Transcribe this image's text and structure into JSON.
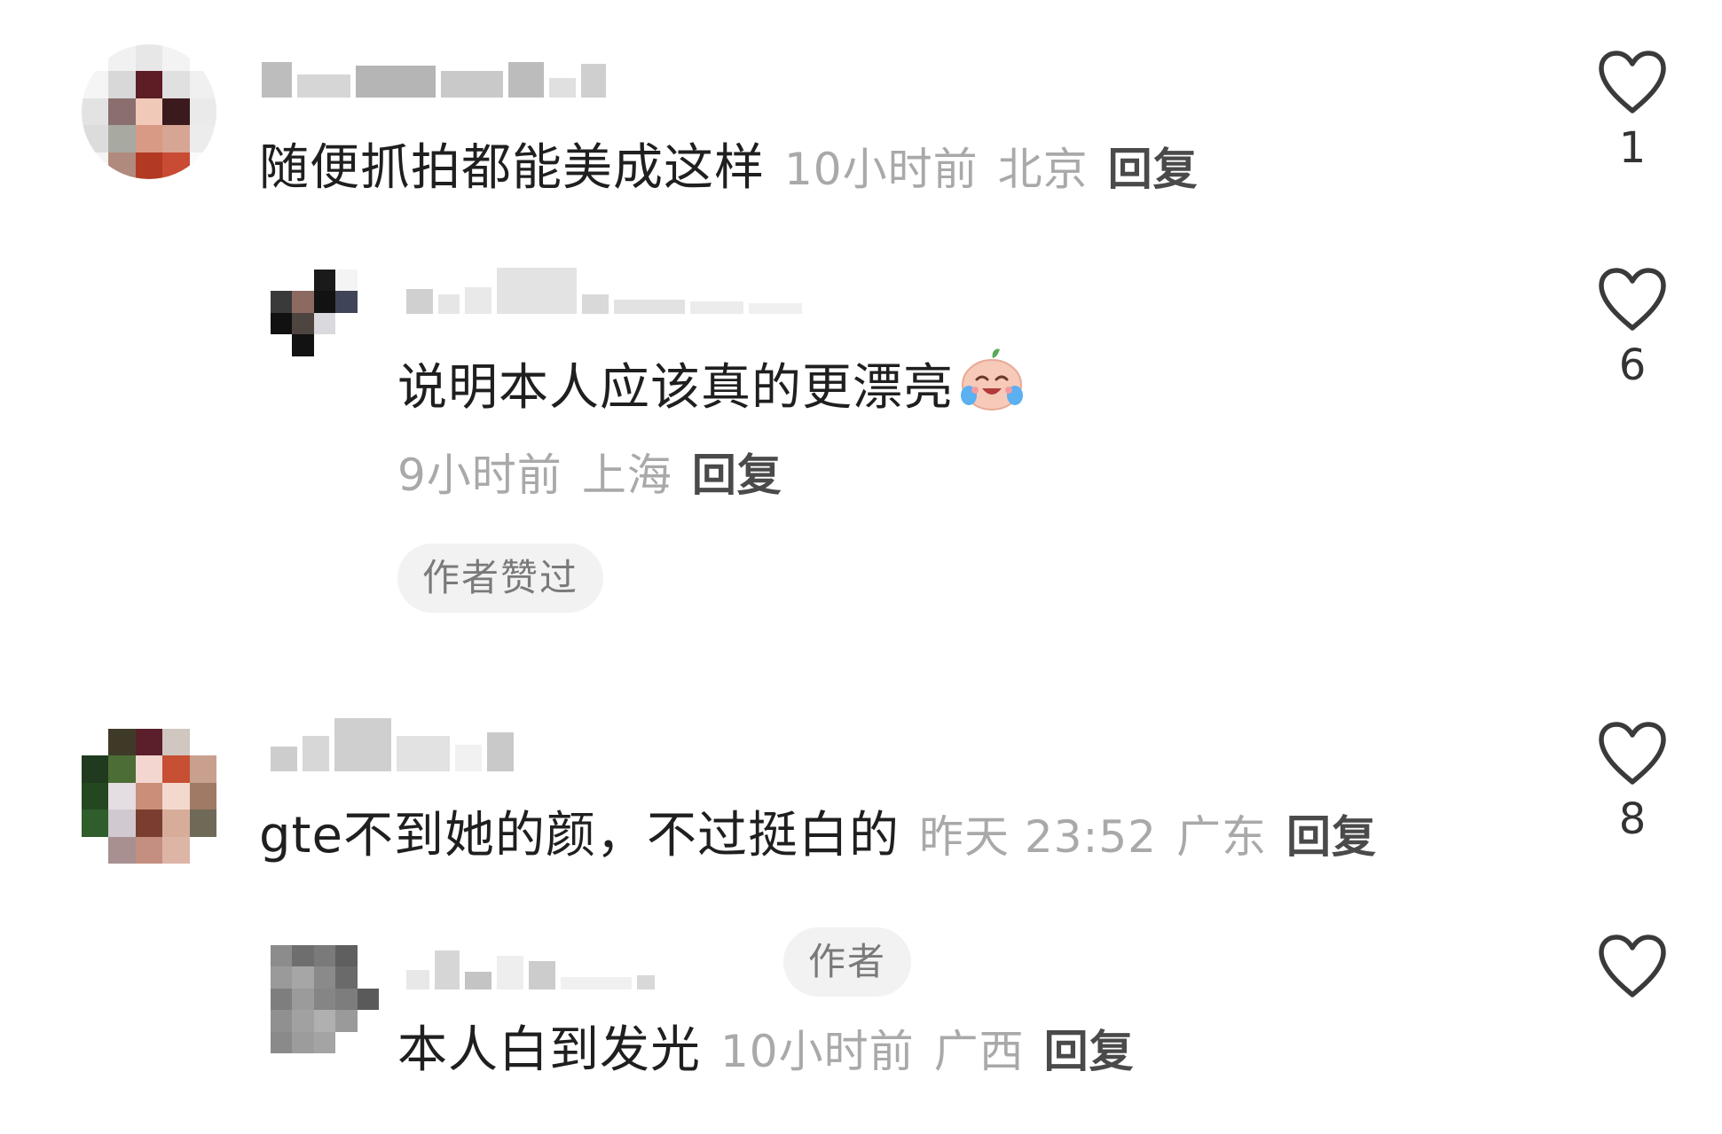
{
  "comments": [
    {
      "text": "随便抓拍都能美成这样",
      "time": "10小时前",
      "location": "北京",
      "reply_label": "回复",
      "likes": "1"
    },
    {
      "text": "说明本人应该真的更漂亮",
      "emoji": "crying-laughing-emoji",
      "time": "9小时前",
      "location": "上海",
      "reply_label": "回复",
      "badge": "作者赞过",
      "likes": "6"
    },
    {
      "text": "gte不到她的颜，不过挺白的",
      "time": "昨天 23:52",
      "location": "广东",
      "reply_label": "回复",
      "likes": "8"
    },
    {
      "author_tag": "作者",
      "text": "本人白到发光",
      "time": "10小时前",
      "location": "广西",
      "reply_label": "回复",
      "likes": ""
    }
  ],
  "icons": {
    "like": "heart-outline-icon"
  },
  "colors": {
    "text": "#1f1f1f",
    "meta": "#a9a9a9",
    "reply": "#4a4a4a",
    "badge_bg": "#f2f2f2",
    "badge_text": "#7a7a7a",
    "heart_stroke": "#3a3a3a"
  }
}
